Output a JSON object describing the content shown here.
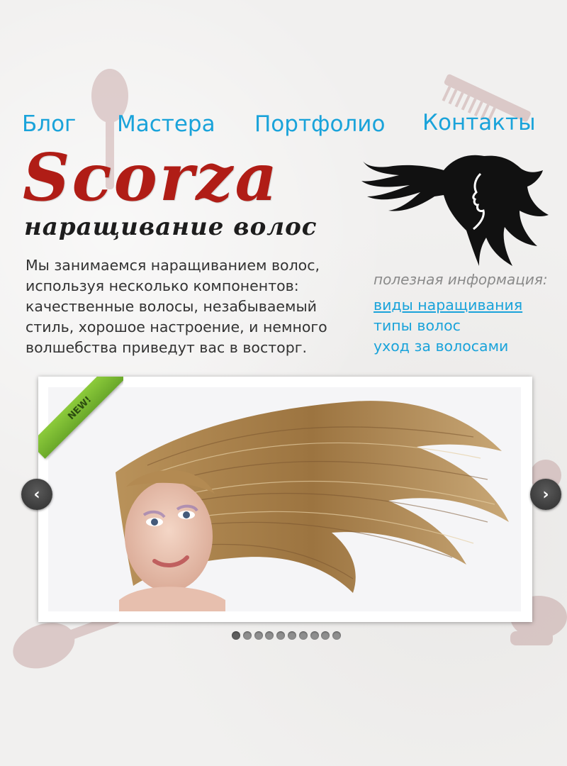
{
  "nav": {
    "items": [
      {
        "label": "Блог"
      },
      {
        "label": "Мастера"
      },
      {
        "label": "Портфолио"
      },
      {
        "label": "Контакты"
      }
    ]
  },
  "brand": {
    "logo": "Scorza",
    "tagline": "наращивание волос"
  },
  "about": {
    "text": "Мы занимаемся наращиванием волос, используя несколько компонентов: качественные волосы, незабываемый стиль, хорошое настроение, и немного волшебства приведут вас в восторг."
  },
  "info": {
    "title": "полезная информация:",
    "links": [
      {
        "label": "виды наращивания"
      },
      {
        "label": "типы волос"
      },
      {
        "label": "уход за волосами"
      }
    ]
  },
  "slider": {
    "badge": "NEW!",
    "prev_icon": "chevron-left-icon",
    "next_icon": "chevron-right-icon",
    "prev_glyph": "‹",
    "next_glyph": "›",
    "dot_count": 10,
    "active_dot": 0
  },
  "colors": {
    "nav_link": "#1aa3da",
    "logo": "#b01d16",
    "ribbon": "#7bbb32"
  }
}
